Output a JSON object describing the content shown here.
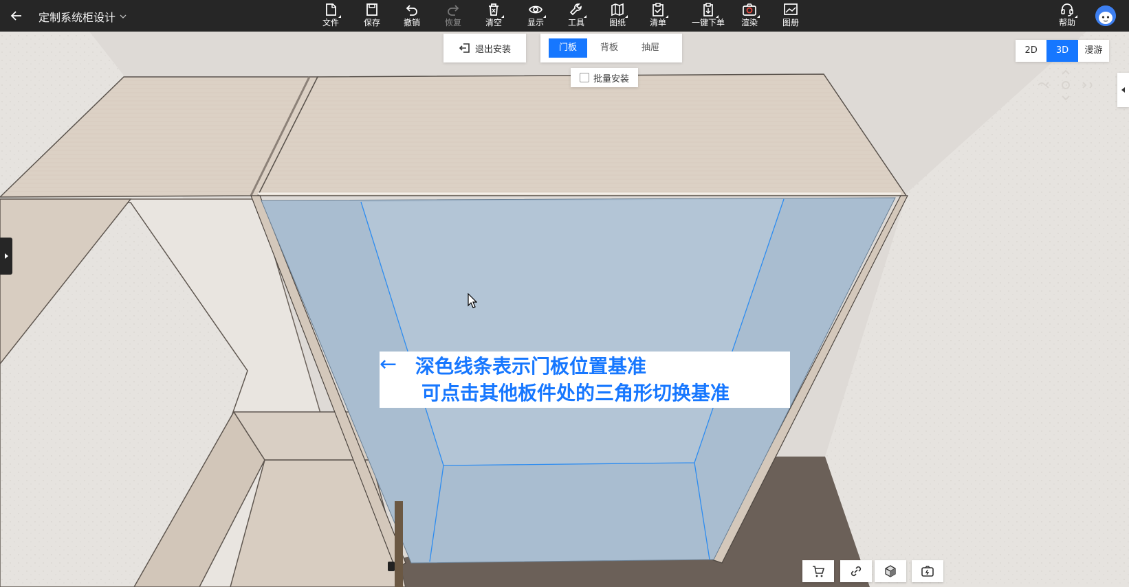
{
  "header": {
    "back_icon": "arrow-left-icon",
    "title": "定制系统柜设计",
    "title_icon": "chevron-down-icon",
    "tools": [
      {
        "label": "文件",
        "icon": "file-icon",
        "disabled": false
      },
      {
        "label": "保存",
        "icon": "save-icon",
        "disabled": false
      },
      {
        "label": "撤销",
        "icon": "undo-icon",
        "disabled": false
      },
      {
        "label": "恢复",
        "icon": "redo-icon",
        "disabled": true
      },
      {
        "label": "清空",
        "icon": "trash-icon",
        "disabled": false
      },
      {
        "label": "显示",
        "icon": "eye-icon",
        "disabled": false
      },
      {
        "label": "工具",
        "icon": "wrench-icon",
        "disabled": false
      },
      {
        "label": "图纸",
        "icon": "map-icon",
        "disabled": false
      },
      {
        "label": "清单",
        "icon": "clipboard-icon",
        "disabled": false
      },
      {
        "label": "一键下单",
        "icon": "order-icon",
        "disabled": false
      },
      {
        "label": "渲染",
        "icon": "camera-icon",
        "disabled": false
      },
      {
        "label": "图册",
        "icon": "image-icon",
        "disabled": false
      }
    ],
    "help_label": "帮助",
    "help_icon": "headset-icon",
    "avatar_icon": "avatar-icon"
  },
  "install_panel": {
    "exit_label": "退出安装",
    "exit_icon": "exit-icon",
    "tabs": [
      {
        "label": "门板",
        "active": true
      },
      {
        "label": "背板",
        "active": false
      },
      {
        "label": "抽屉",
        "active": false
      }
    ],
    "batch_label": "批量安装",
    "batch_checked": false
  },
  "view_modes": [
    {
      "label": "2D",
      "active": false
    },
    {
      "label": "3D",
      "active": true
    },
    {
      "label": "漫游",
      "active": false
    }
  ],
  "annotation": {
    "arrow": "←",
    "line1": "深色线条表示门板位置基准",
    "line2": "可点击其他板件处的三角形切换基准"
  },
  "bottom_tools": [
    "cart-icon",
    "link-icon",
    "cube-icon",
    "screenshot-icon"
  ],
  "colors": {
    "toolbar_bg": "#262626",
    "accent": "#1677ff",
    "highlight_face": "#a9bdd0",
    "wood": "#ddd2c6",
    "floor": "#6b6058"
  }
}
